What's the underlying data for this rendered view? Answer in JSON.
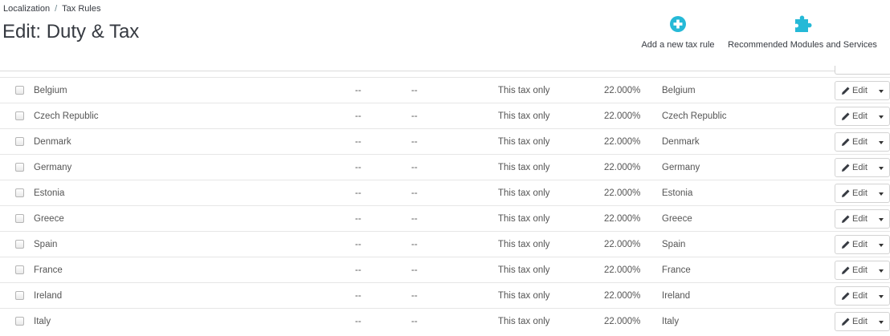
{
  "breadcrumb": {
    "parent": "Localization",
    "separator": "/",
    "current": "Tax Rules"
  },
  "page": {
    "title": "Edit: Duty & Tax"
  },
  "toolbar": {
    "add_label": "Add a new tax rule",
    "add_icon": "plus-circle-icon",
    "recommended_label": "Recommended Modules and Services",
    "recommended_icon": "puzzle-icon",
    "accent_color": "#25b9d7"
  },
  "actions": {
    "edit_label": "Edit",
    "edit_icon": "pencil-icon",
    "menu_icon": "caret-down-icon"
  },
  "rows": [
    {
      "country": "Belgium",
      "zip": "--",
      "state": "--",
      "behavior": "This tax only",
      "rate": "22.000%",
      "description": "Belgium"
    },
    {
      "country": "Czech Republic",
      "zip": "--",
      "state": "--",
      "behavior": "This tax only",
      "rate": "22.000%",
      "description": "Czech Republic"
    },
    {
      "country": "Denmark",
      "zip": "--",
      "state": "--",
      "behavior": "This tax only",
      "rate": "22.000%",
      "description": "Denmark"
    },
    {
      "country": "Germany",
      "zip": "--",
      "state": "--",
      "behavior": "This tax only",
      "rate": "22.000%",
      "description": "Germany"
    },
    {
      "country": "Estonia",
      "zip": "--",
      "state": "--",
      "behavior": "This tax only",
      "rate": "22.000%",
      "description": "Estonia"
    },
    {
      "country": "Greece",
      "zip": "--",
      "state": "--",
      "behavior": "This tax only",
      "rate": "22.000%",
      "description": "Greece"
    },
    {
      "country": "Spain",
      "zip": "--",
      "state": "--",
      "behavior": "This tax only",
      "rate": "22.000%",
      "description": "Spain"
    },
    {
      "country": "France",
      "zip": "--",
      "state": "--",
      "behavior": "This tax only",
      "rate": "22.000%",
      "description": "France"
    },
    {
      "country": "Ireland",
      "zip": "--",
      "state": "--",
      "behavior": "This tax only",
      "rate": "22.000%",
      "description": "Ireland"
    },
    {
      "country": "Italy",
      "zip": "--",
      "state": "--",
      "behavior": "This tax only",
      "rate": "22.000%",
      "description": "Italy"
    }
  ]
}
